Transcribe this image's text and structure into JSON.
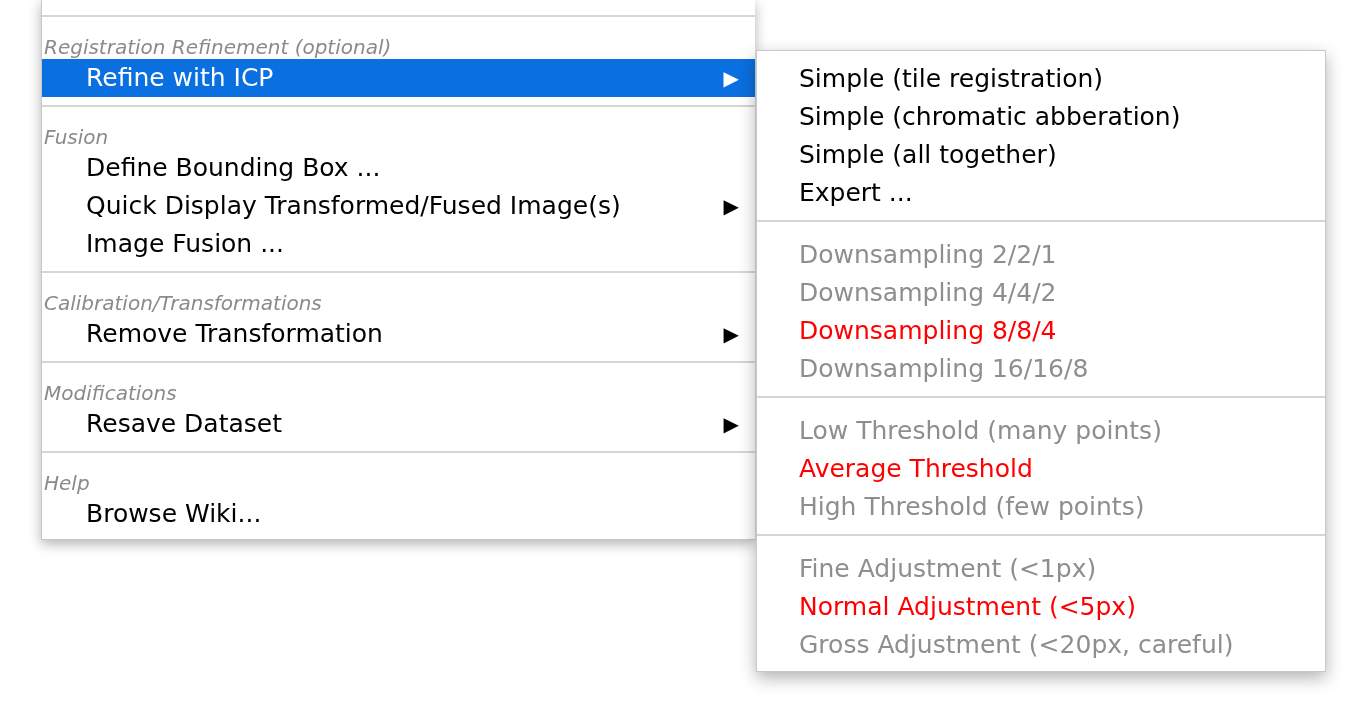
{
  "menu": [
    {
      "kind": "separator"
    },
    {
      "kind": "header",
      "label": "Registration Refinement (optional)"
    },
    {
      "kind": "item",
      "label": "Refine with ICP",
      "arrow": "▶",
      "selected": true
    },
    {
      "kind": "separator"
    },
    {
      "kind": "header",
      "label": "Fusion"
    },
    {
      "kind": "item",
      "label": "Define Bounding Box ...",
      "selected": false
    },
    {
      "kind": "item",
      "label": "Quick Display Transformed/Fused Image(s)",
      "arrow": "▶",
      "selected": false
    },
    {
      "kind": "item",
      "label": "Image Fusion ...",
      "selected": false
    },
    {
      "kind": "separator"
    },
    {
      "kind": "header",
      "label": "Calibration/Transformations"
    },
    {
      "kind": "item",
      "label": "Remove Transformation",
      "arrow": "▶",
      "selected": false
    },
    {
      "kind": "separator"
    },
    {
      "kind": "header",
      "label": "Modifications"
    },
    {
      "kind": "item",
      "label": "Resave Dataset",
      "arrow": "▶",
      "selected": false
    },
    {
      "kind": "separator"
    },
    {
      "kind": "header",
      "label": "Help"
    },
    {
      "kind": "item",
      "label": "Browse Wiki...",
      "selected": false
    }
  ],
  "submenu": [
    {
      "kind": "action",
      "label": "Simple (tile registration)"
    },
    {
      "kind": "action",
      "label": "Simple (chromatic abberation)"
    },
    {
      "kind": "action",
      "label": "Simple (all together)"
    },
    {
      "kind": "action",
      "label": "Expert ..."
    },
    {
      "kind": "separator"
    },
    {
      "kind": "option",
      "label": "Downsampling 2/2/1",
      "selected": false
    },
    {
      "kind": "option",
      "label": "Downsampling 4/4/2",
      "selected": false
    },
    {
      "kind": "option",
      "label": "Downsampling 8/8/4",
      "selected": true
    },
    {
      "kind": "option",
      "label": "Downsampling 16/16/8",
      "selected": false
    },
    {
      "kind": "separator"
    },
    {
      "kind": "option",
      "label": "Low Threshold (many points)",
      "selected": false
    },
    {
      "kind": "option",
      "label": "Average Threshold",
      "selected": true
    },
    {
      "kind": "option",
      "label": "High Threshold (few points)",
      "selected": false
    },
    {
      "kind": "separator"
    },
    {
      "kind": "option",
      "label": "Fine Adjustment (<1px)",
      "selected": false
    },
    {
      "kind": "option",
      "label": "Normal Adjustment (<5px)",
      "selected": true
    },
    {
      "kind": "option",
      "label": "Gross Adjustment (<20px, careful)",
      "selected": false
    }
  ]
}
